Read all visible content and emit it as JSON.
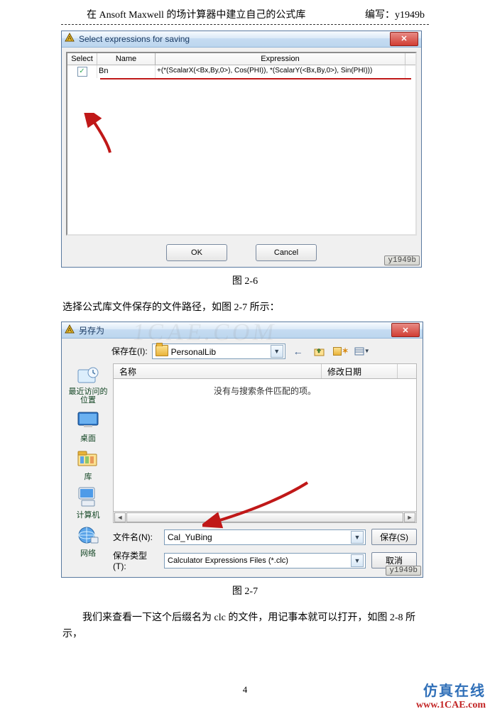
{
  "header": {
    "title": "在 Ansoft Maxwell 的场计算器中建立自己的公式库",
    "author_label": "编写：y1949b"
  },
  "fig26": {
    "window_title": "Select expressions for saving",
    "columns": {
      "select": "Select",
      "name": "Name",
      "expression": "Expression"
    },
    "row": {
      "checked": "✓",
      "name": "Bn",
      "expression": "+(*(ScalarX(<Bx,By,0>), Cos(PHI)), *(ScalarY(<Bx,By,0>), Sin(PHI)))"
    },
    "ok": "OK",
    "cancel": "Cancel",
    "watermark": "y1949b",
    "caption": "图 2-6"
  },
  "para1": "选择公式库文件保存的文件路径，如图 2-7 所示：",
  "fig27": {
    "window_title": "另存为",
    "save_in_label": "保存在(I):",
    "folder_name": "PersonalLib",
    "column_name": "名称",
    "column_date": "修改日期",
    "empty_text": "没有与搜索条件匹配的项。",
    "sidebar": {
      "recent": "最近访问的位置",
      "desktop": "桌面",
      "libraries": "库",
      "computer": "计算机",
      "network": "网络"
    },
    "filename_label": "文件名(N):",
    "filename_value": "Cal_YuBing",
    "filetype_label": "保存类型(T):",
    "filetype_value": "Calculator Expressions Files (*.clc)",
    "save_btn": "保存(S)",
    "cancel_btn": "取消",
    "watermark": "y1949b",
    "caption": "图 2-7",
    "bg_watermark": "1CAE.COM"
  },
  "para2": "我们来查看一下这个后缀名为 clc 的文件，用记事本就可以打开，如图 2-8 所示，",
  "page_number": "4",
  "brand": {
    "cn": "仿真在线",
    "en": "www.1CAE.com"
  }
}
